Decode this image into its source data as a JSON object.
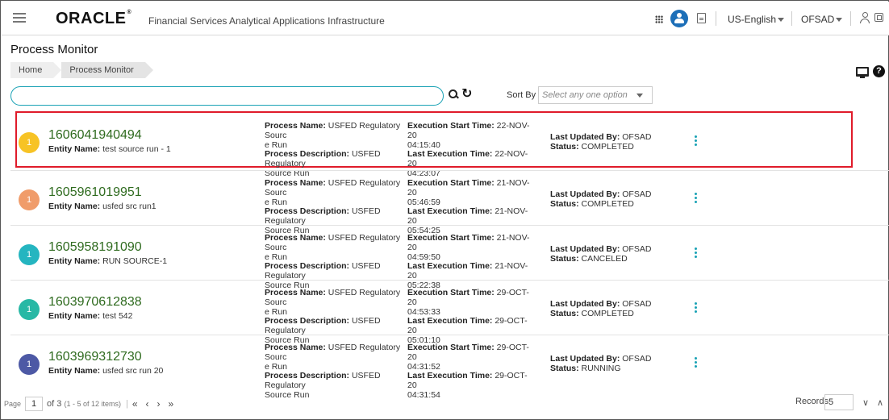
{
  "header": {
    "logo": "ORACLE",
    "app_title": "Financial Services Analytical Applications Infrastructure",
    "language": "US-English",
    "user": "OFSAD"
  },
  "page": {
    "title": "Process Monitor",
    "breadcrumb": [
      "Home",
      "Process Monitor"
    ]
  },
  "search": {
    "placeholder": "",
    "sort_label": "Sort By",
    "sort_placeholder": "Select any one option"
  },
  "labels": {
    "entity_name": "Entity Name:",
    "process_name": "Process Name:",
    "process_desc": "Process Description:",
    "exec_start": "Execution Start Time:",
    "last_exec": "Last Execution Time:",
    "last_updated": "Last Updated By:",
    "status": "Status:"
  },
  "colors": {
    "badge_yellow": "#f7c325",
    "badge_orange": "#f09c6a",
    "badge_teal": "#25b5c0",
    "badge_green": "#28b8a5",
    "badge_indigo": "#4d59a5",
    "highlight": "#e01b2a"
  },
  "processes": [
    {
      "badge": "1",
      "id": "1606041940494",
      "entity": "test source run - 1",
      "process_name_l1": "USFED Regulatory Sourc",
      "process_name_l2": "e Run",
      "process_desc_l1": "USFED Regulatory",
      "process_desc_l2": "Source Run",
      "exec_start_l1": "22-NOV-20",
      "exec_start_l2": "04:15:40",
      "last_exec_l1": "22-NOV-20",
      "last_exec_l2": "04:23:07",
      "updated_by": "OFSAD",
      "status": "COMPLETED"
    },
    {
      "badge": "1",
      "id": "1605961019951",
      "entity": "usfed src run1",
      "process_name_l1": "USFED Regulatory Sourc",
      "process_name_l2": "e Run",
      "process_desc_l1": "USFED Regulatory",
      "process_desc_l2": "Source Run",
      "exec_start_l1": "21-NOV-20",
      "exec_start_l2": "05:46:59",
      "last_exec_l1": "21-NOV-20",
      "last_exec_l2": "05:54:25",
      "updated_by": "OFSAD",
      "status": "COMPLETED"
    },
    {
      "badge": "1",
      "id": "1605958191090",
      "entity": "RUN SOURCE-1",
      "process_name_l1": "USFED Regulatory Sourc",
      "process_name_l2": "e Run",
      "process_desc_l1": "USFED Regulatory",
      "process_desc_l2": "Source Run",
      "exec_start_l1": "21-NOV-20",
      "exec_start_l2": "04:59:50",
      "last_exec_l1": "21-NOV-20",
      "last_exec_l2": "05:22:38",
      "updated_by": "OFSAD",
      "status": "CANCELED"
    },
    {
      "badge": "1",
      "id": "1603970612838",
      "entity": "test 542",
      "process_name_l1": "USFED Regulatory Sourc",
      "process_name_l2": "e Run",
      "process_desc_l1": "USFED Regulatory",
      "process_desc_l2": "Source Run",
      "exec_start_l1": "29-OCT-20",
      "exec_start_l2": "04:53:33",
      "last_exec_l1": "29-OCT-20",
      "last_exec_l2": "05:01:10",
      "updated_by": "OFSAD",
      "status": "COMPLETED"
    },
    {
      "badge": "1",
      "id": "1603969312730",
      "entity": "usfed src run 20",
      "process_name_l1": "USFED Regulatory Sourc",
      "process_name_l2": "e Run",
      "process_desc_l1": "USFED Regulatory",
      "process_desc_l2": "Source Run",
      "exec_start_l1": "29-OCT-20",
      "exec_start_l2": "04:31:52",
      "last_exec_l1": "29-OCT-20",
      "last_exec_l2": "04:31:54",
      "updated_by": "OFSAD",
      "status": "RUNNING"
    }
  ],
  "pagination": {
    "page_label": "Page",
    "current_page": "1",
    "of_label": "of",
    "total_pages": "3",
    "range_text": "(1 - 5 of 12 items)",
    "records_label": "Records",
    "records_value": "5"
  }
}
